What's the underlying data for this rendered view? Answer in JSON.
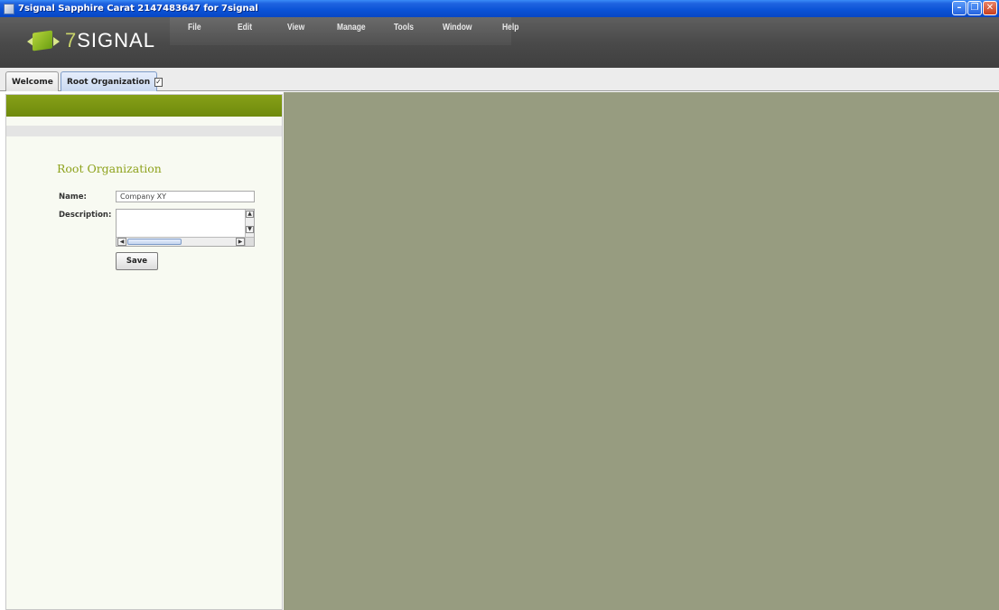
{
  "window": {
    "title": "7signal Sapphire Carat  2147483647 for 7signal",
    "controls": {
      "minimize": "–",
      "restore": "❐",
      "close": "✕"
    }
  },
  "header": {
    "logo_prefix": "7",
    "logo_text": "SIGNAL"
  },
  "menu": {
    "items": [
      "File",
      "Edit",
      "View",
      "Manage",
      "Tools",
      "Window",
      "Help"
    ]
  },
  "tabs": [
    {
      "label": "Welcome",
      "active": false
    },
    {
      "label": "Root Organization",
      "active": true,
      "check": "✓"
    }
  ],
  "form": {
    "title": "Root Organization",
    "name_label": "Name:",
    "name_value": "Company XY",
    "description_label": "Description:",
    "description_value": "",
    "save_label": "Save"
  },
  "colors": {
    "accent_green": "#7a9412",
    "title_green": "#8ea21c",
    "content_bg": "#979c80"
  }
}
